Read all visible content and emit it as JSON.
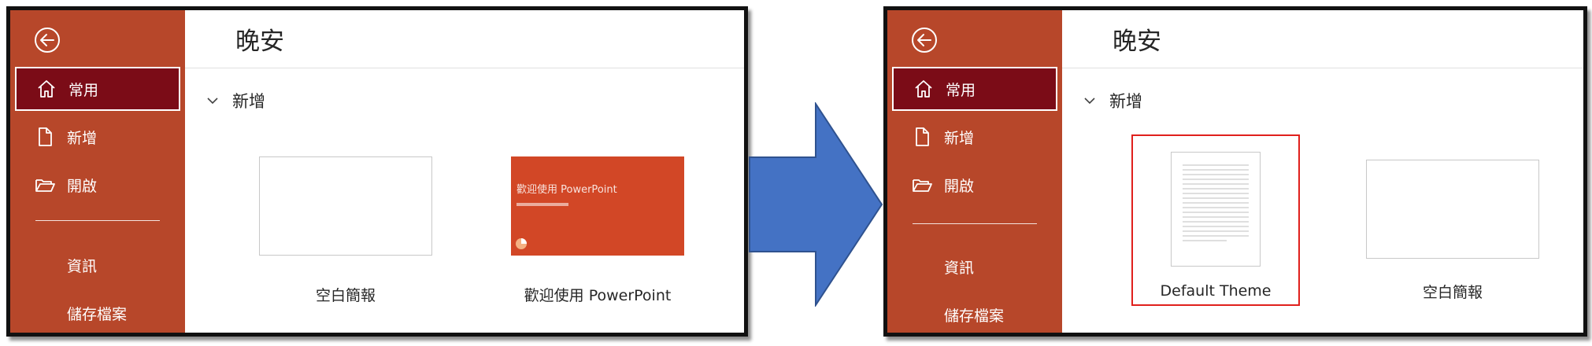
{
  "left_window": {
    "greeting": "晚安",
    "nav": [
      {
        "label": "常用",
        "icon": "home-icon"
      },
      {
        "label": "新增",
        "icon": "new-file-icon"
      },
      {
        "label": "開啟",
        "icon": "open-folder-icon"
      },
      {
        "label": "資訊"
      },
      {
        "label": "儲存檔案"
      }
    ],
    "section_title": "新增",
    "templates": [
      {
        "label": "空白簡報"
      },
      {
        "label": "歡迎使用 PowerPoint",
        "thumb_title": "歡迎使用 PowerPoint"
      }
    ]
  },
  "right_window": {
    "greeting": "晚安",
    "nav": [
      {
        "label": "常用",
        "icon": "home-icon"
      },
      {
        "label": "新增",
        "icon": "new-file-icon"
      },
      {
        "label": "開啟",
        "icon": "open-folder-icon"
      },
      {
        "label": "資訊"
      },
      {
        "label": "儲存檔案"
      }
    ],
    "section_title": "新增",
    "templates": [
      {
        "label": "Default Theme"
      },
      {
        "label": "空白簡報"
      }
    ]
  },
  "colors": {
    "sidebar": "#b7472a",
    "selected_nav": "#7b0c17",
    "welcome_thumb": "#d24726",
    "highlight": "#e0201c",
    "arrow": "#4472c4"
  }
}
